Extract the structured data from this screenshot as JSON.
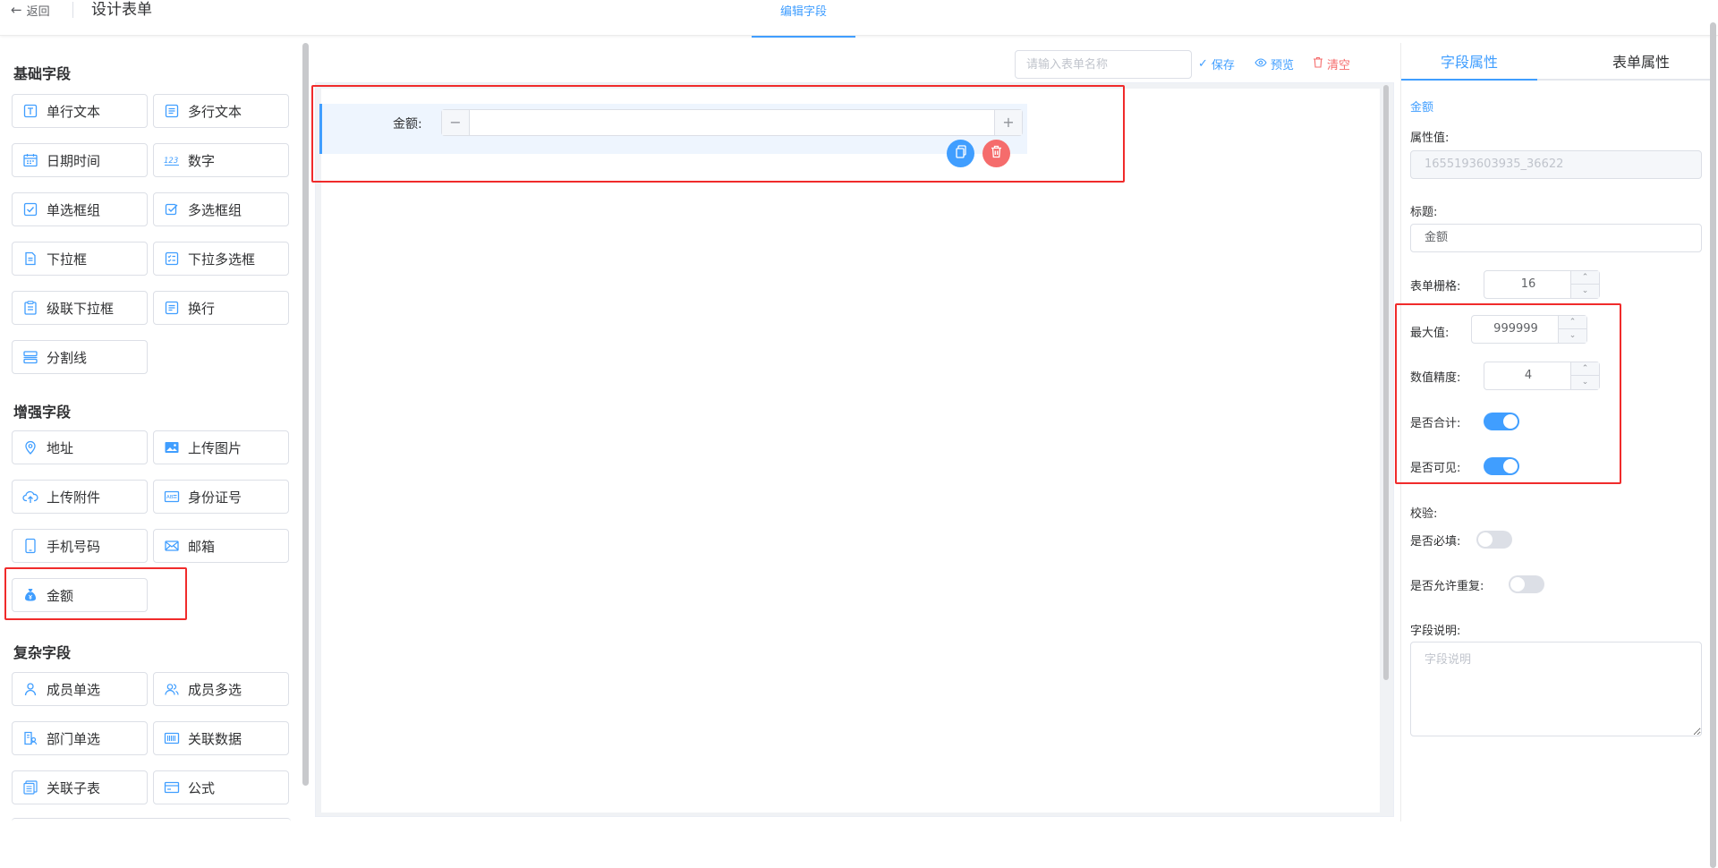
{
  "header": {
    "back_label": "返回",
    "title": "设计表单",
    "active_tab": "编辑字段"
  },
  "left_panel": {
    "groups": [
      {
        "title": "基础字段",
        "items": [
          {
            "label": "单行文本",
            "icon": "text-input-icon"
          },
          {
            "label": "多行文本",
            "icon": "textarea-icon"
          },
          {
            "label": "日期时间",
            "icon": "calendar-icon"
          },
          {
            "label": "数字",
            "icon": "number-icon"
          },
          {
            "label": "单选框组",
            "icon": "radio-check-icon"
          },
          {
            "label": "多选框组",
            "icon": "checkbox-group-icon"
          },
          {
            "label": "下拉框",
            "icon": "select-icon"
          },
          {
            "label": "下拉多选框",
            "icon": "multi-select-icon"
          },
          {
            "label": "级联下拉框",
            "icon": "cascader-icon"
          },
          {
            "label": "换行",
            "icon": "linebreak-icon"
          },
          {
            "label": "分割线",
            "icon": "divider-icon"
          }
        ]
      },
      {
        "title": "增强字段",
        "items": [
          {
            "label": "地址",
            "icon": "location-icon"
          },
          {
            "label": "上传图片",
            "icon": "image-icon"
          },
          {
            "label": "上传附件",
            "icon": "cloud-upload-icon"
          },
          {
            "label": "身份证号",
            "icon": "id-card-icon"
          },
          {
            "label": "手机号码",
            "icon": "phone-icon"
          },
          {
            "label": "邮箱",
            "icon": "mail-icon"
          },
          {
            "label": "金额",
            "icon": "money-bag-icon"
          }
        ]
      },
      {
        "title": "复杂字段",
        "items": [
          {
            "label": "成员单选",
            "icon": "user-icon"
          },
          {
            "label": "成员多选",
            "icon": "users-icon"
          },
          {
            "label": "部门单选",
            "icon": "department-icon"
          },
          {
            "label": "关联数据",
            "icon": "barcode-icon"
          },
          {
            "label": "关联子表",
            "icon": "subtable-icon"
          },
          {
            "label": "公式",
            "icon": "formula-icon"
          }
        ]
      }
    ]
  },
  "toolbar": {
    "form_name_placeholder": "请输入表单名称",
    "save_label": "保存",
    "preview_label": "预览",
    "clear_label": "清空"
  },
  "canvas": {
    "field_label": "金额:",
    "minus": "−",
    "plus": "+"
  },
  "right_panel": {
    "tabs": [
      "字段属性",
      "表单属性"
    ],
    "field_type": "金额",
    "attr_value_label": "属性值:",
    "attr_value": "1655193603935_36622",
    "title_label": "标题:",
    "title_value": "金额",
    "grid_label": "表单栅格:",
    "grid_value": "16",
    "max_label": "最大值:",
    "max_value": "999999",
    "precision_label": "数值精度:",
    "precision_value": "4",
    "sum_label": "是否合计:",
    "sum_on": true,
    "visible_label": "是否可见:",
    "visible_on": true,
    "validate_label": "校验:",
    "required_label": "是否必填:",
    "required_on": false,
    "duplicate_label": "是否允许重复:",
    "duplicate_on": false,
    "desc_label": "字段说明:",
    "desc_placeholder": "字段说明"
  },
  "colors": {
    "primary": "#409eff",
    "danger": "#f56c6c",
    "highlight_box": "#f02b2b"
  }
}
